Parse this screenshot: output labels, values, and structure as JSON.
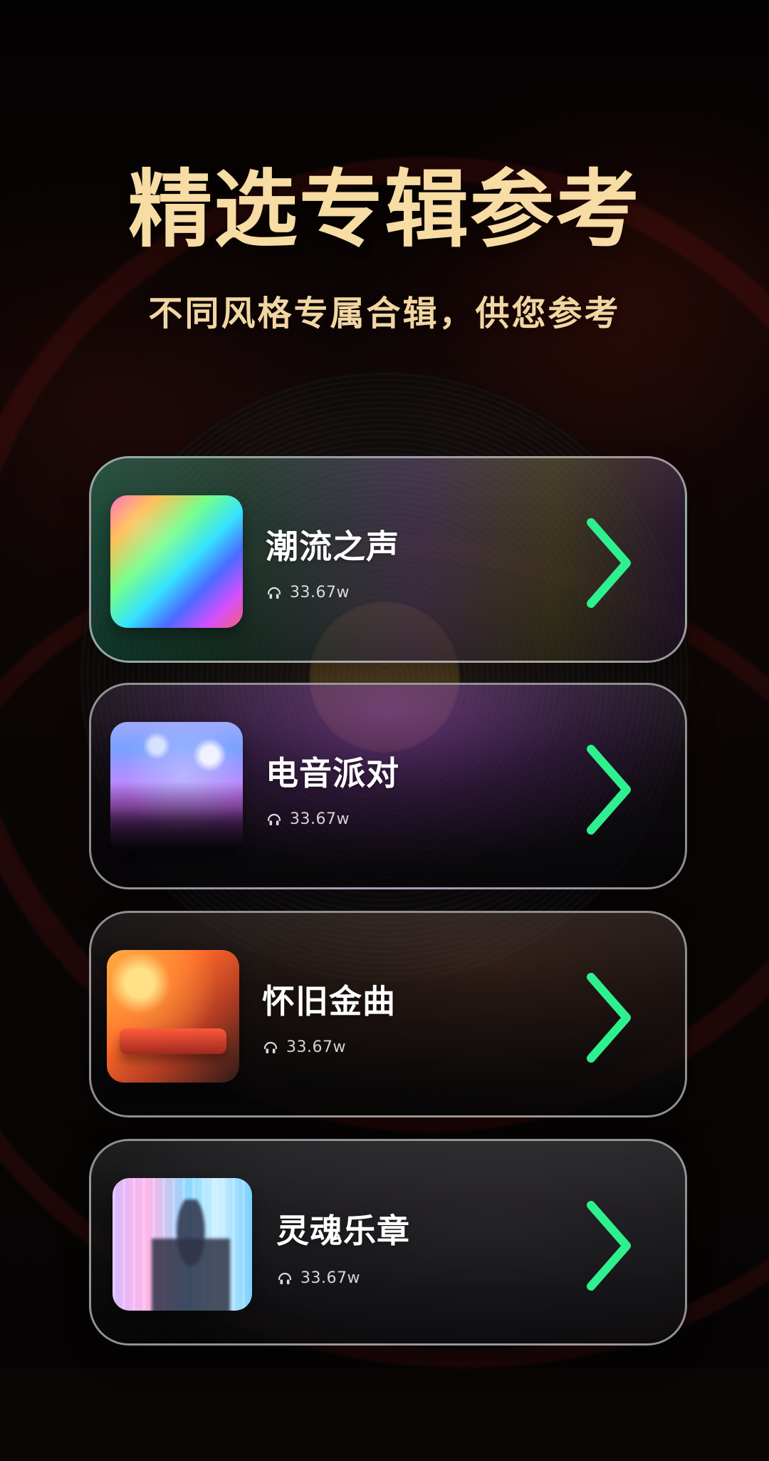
{
  "header": {
    "title": "精选专辑参考",
    "subtitle": "不同风格专属合辑，供您参考"
  },
  "albums": [
    {
      "title": "潮流之声",
      "plays": "33.67w",
      "icon": "headphones-icon"
    },
    {
      "title": "电音派对",
      "plays": "33.67w",
      "icon": "headphones-icon"
    },
    {
      "title": "怀旧金曲",
      "plays": "33.67w",
      "icon": "headphones-icon"
    },
    {
      "title": "灵魂乐章",
      "plays": "33.67w",
      "icon": "headphones-icon"
    }
  ],
  "colors": {
    "title_gold": "#f7dca3",
    "arrow_green": "#2ff08f"
  }
}
